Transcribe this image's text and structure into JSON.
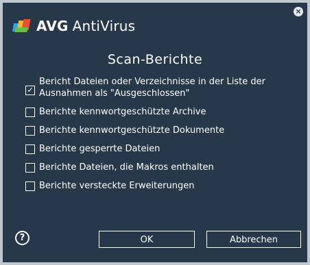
{
  "app": {
    "brand_bold": "AVG",
    "brand_name": "AntiVirus",
    "close_glyph": "×"
  },
  "dialog_title": "Scan-Berichte",
  "options": [
    {
      "label": "Bericht Dateien oder Verzeichnisse in der Liste der Ausnahmen als \"Ausgeschlossen\"",
      "checked": true
    },
    {
      "label": "Berichte kennwortgeschützte Archive",
      "checked": false
    },
    {
      "label": "Berichte kennwortgeschützte Dokumente",
      "checked": false
    },
    {
      "label": "Berichte gesperrte Dateien",
      "checked": false
    },
    {
      "label": "Berichte Dateien, die Makros enthalten",
      "checked": false
    },
    {
      "label": "Berichte versteckte Erweiterungen",
      "checked": false
    }
  ],
  "buttons": {
    "ok": "OK",
    "cancel": "Abbrechen",
    "help": "?"
  },
  "colors": {
    "background": "#27384a",
    "text": "#ffffff"
  }
}
